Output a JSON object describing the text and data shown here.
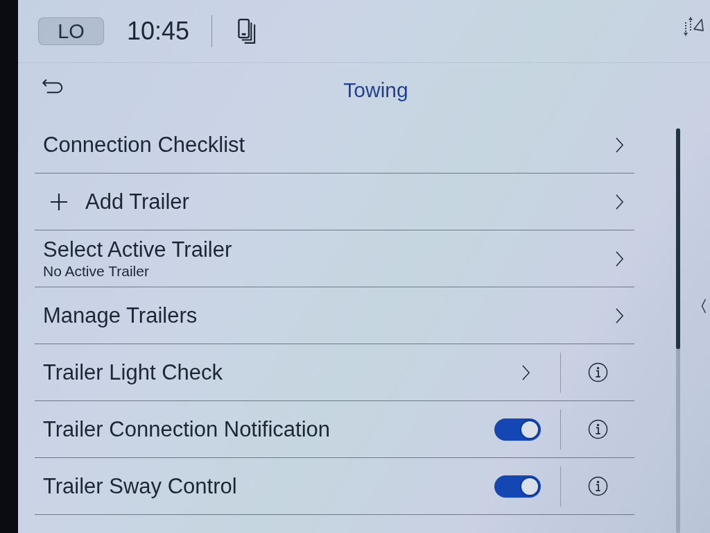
{
  "status_bar": {
    "badge": "LO",
    "time": "10:45"
  },
  "header": {
    "title": "Towing"
  },
  "items": [
    {
      "kind": "link",
      "label": "Connection Checklist",
      "info": false
    },
    {
      "kind": "add",
      "label": "Add Trailer",
      "info": false
    },
    {
      "kind": "link",
      "label": "Select Active Trailer",
      "subtitle": "No Active Trailer",
      "info": false
    },
    {
      "kind": "link",
      "label": "Manage Trailers",
      "info": false
    },
    {
      "kind": "link",
      "label": "Trailer Light Check",
      "info": true
    },
    {
      "kind": "toggle",
      "label": "Trailer Connection Notification",
      "on": true,
      "info": true
    },
    {
      "kind": "toggle",
      "label": "Trailer Sway Control",
      "on": true,
      "info": true
    }
  ]
}
